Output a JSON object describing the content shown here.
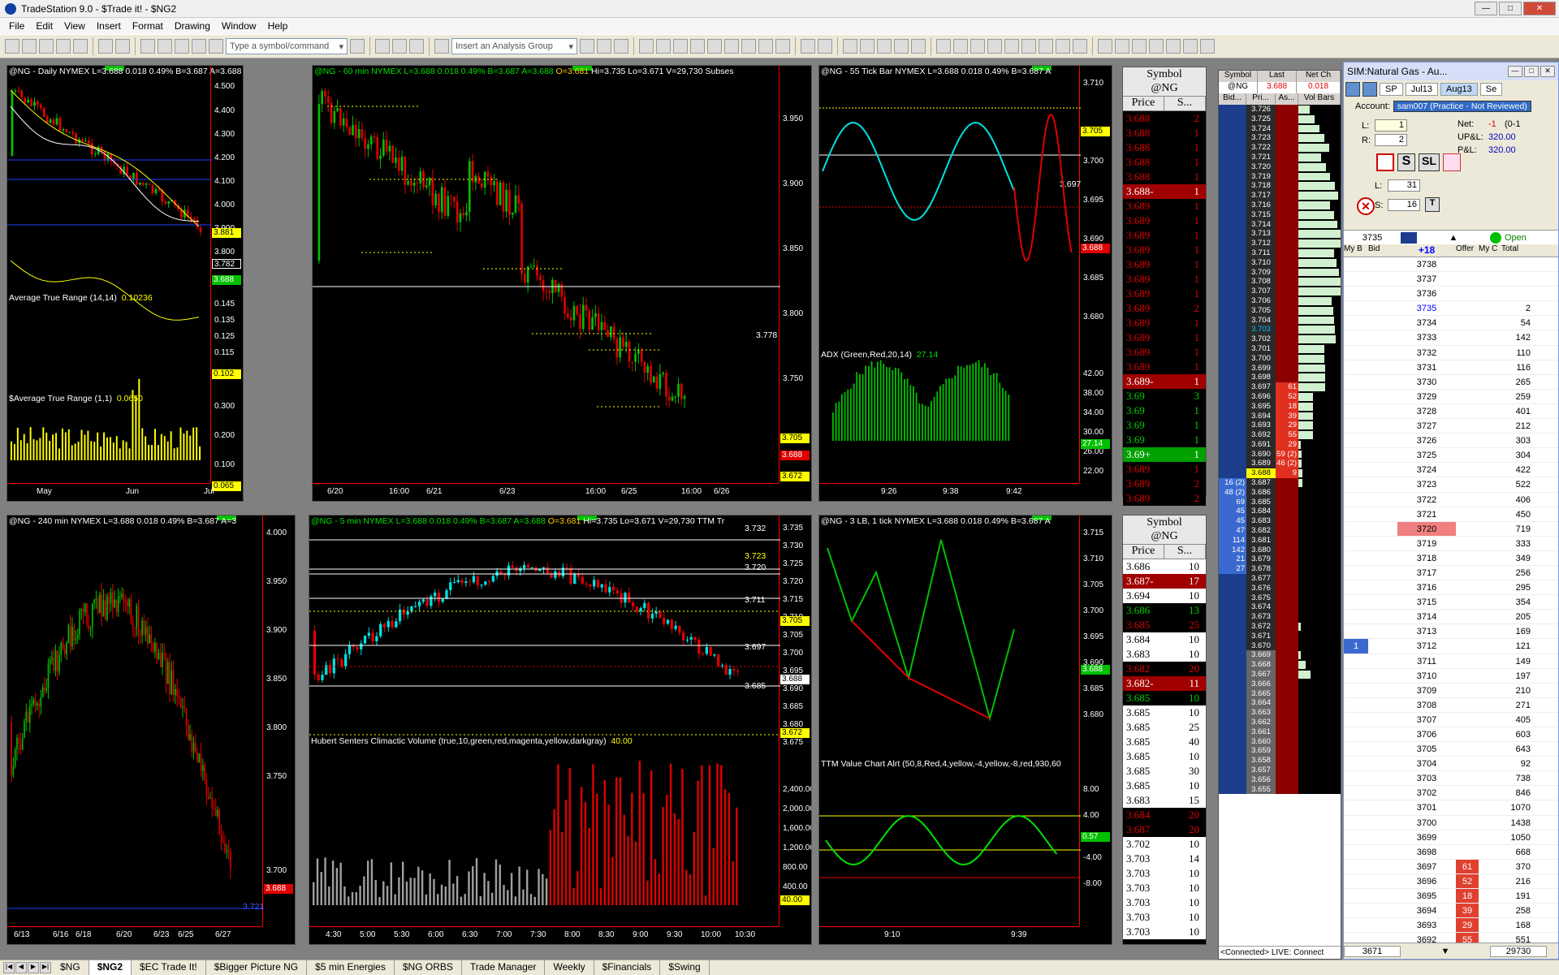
{
  "window": {
    "title": "TradeStation 9.0 - $Trade it! - $NG2"
  },
  "menu": [
    "File",
    "Edit",
    "View",
    "Insert",
    "Format",
    "Drawing",
    "Window",
    "Help"
  ],
  "toolbar": {
    "symbol_placeholder": "Type a symbol/command",
    "analysis_placeholder": "Insert an Analysis Group"
  },
  "charts": {
    "daily": {
      "header": "@NG - Daily  NYMEX  L=3.688  0.018  0.49%  B=3.687  A=3.688",
      "ticks": [
        "4.500",
        "4.400",
        "4.300",
        "4.200",
        "4.100",
        "4.000",
        "3.900",
        "3.800"
      ],
      "price_tags": [
        "3.881",
        "3.782",
        "3.688"
      ],
      "sub1_label": "Average True Range (14,14)",
      "sub1_value": "0.10236",
      "sub1_ticks": [
        "0.145",
        "0.135",
        "0.125",
        "0.115"
      ],
      "sub1_tag": "0.102",
      "sub2_label": "$Average True Range (1,1)",
      "sub2_value": "0.0650",
      "sub2_ticks": [
        "0.300",
        "0.200",
        "0.100"
      ],
      "sub2_tag": "0.065",
      "x": [
        "May",
        "Jun",
        "Jul"
      ]
    },
    "min60": {
      "header_a": "@NG - 60 min  NYMEX  L=3.688  0.018  0.49%  B=3.687  A=3.688  ",
      "header_o": "O=3.681",
      "header_b": "  Hi=3.735  Lo=3.671  V=29,730  Subses",
      "ticks": [
        "3.950",
        "3.900",
        "3.850",
        "3.800",
        "3.750"
      ],
      "line_label": "3.778",
      "price_tags": [
        "3.705",
        "3.688",
        "3.672"
      ],
      "x": [
        "6/20",
        "16:00",
        "6/21",
        "6/23",
        "16:00",
        "6/25",
        "16:00",
        "6/26"
      ]
    },
    "tick55": {
      "header": "@NG - 55 Tick Bar  NYMEX  L=3.688  0.018  0.49%  B=3.687  A",
      "ticks": [
        "3.710",
        "3.700",
        "3.695",
        "3.690",
        "3.685",
        "3.680"
      ],
      "line_label": "3.697",
      "price_tags": [
        "3.705",
        "3.688"
      ],
      "sub_label": "ADX (Green,Red,20,14)",
      "sub_value": "27.14",
      "sub_ticks": [
        "42.00",
        "38.00",
        "34.00",
        "30.00",
        "26.00",
        "22.00"
      ],
      "sub_tag": "27.14",
      "x": [
        "9:26",
        "9:38",
        "9:42"
      ]
    },
    "min240": {
      "header": "@NG - 240 min  NYMEX  L=3.688  0.018  0.49%  B=3.687  A=3",
      "ticks": [
        "4.000",
        "3.950",
        "3.900",
        "3.850",
        "3.800",
        "3.750",
        "3.700"
      ],
      "line_label": "3.721",
      "price_tags": [
        "3.688"
      ],
      "x": [
        "6/13",
        "6/16",
        "6/18",
        "6/20",
        "6/23",
        "6/25",
        "6/27"
      ]
    },
    "min5": {
      "header_a": "@NG - 5 min  NYMEX  L=3.688  0.018  0.49%  B=3.687  A=3.688  ",
      "header_o": "O=3.681",
      "header_b": "  Hi=3.735  Lo=3.671  V=29,730  TTM Tr",
      "ticks": [
        "3.735",
        "3.730",
        "3.725",
        "3.720",
        "3.715",
        "3.710",
        "3.705",
        "3.700",
        "3.695",
        "3.690",
        "3.685",
        "3.680",
        "3.675"
      ],
      "line_labels": [
        "3.732",
        "3.723",
        "3.720",
        "3.711",
        "3.697",
        "3.685"
      ],
      "price_tags": [
        "3.705",
        "3.688",
        "3.672"
      ],
      "sub_label": "Hubert Senters Climactic Volume (true,10,green,red,magenta,yellow,darkgray)",
      "sub_value": "40.00",
      "sub_ticks": [
        "2,400.00",
        "2,000.00",
        "1,600.00",
        "1,200.00",
        "800.00",
        "400.00"
      ],
      "sub_tag": "40.00",
      "x": [
        "4:30",
        "5:00",
        "5:30",
        "6:00",
        "6:30",
        "7:00",
        "7:30",
        "8:00",
        "8:30",
        "9:00",
        "9:30",
        "10:00",
        "10:30"
      ]
    },
    "lb3": {
      "header": "@NG - 3 LB, 1 tick  NYMEX  L=3.688  0.018  0.49%  B=3.687  A",
      "ticks": [
        "3.715",
        "3.710",
        "3.705",
        "3.700",
        "3.695",
        "3.690",
        "3.685",
        "3.680"
      ],
      "price_tags": [
        "3.688"
      ],
      "sub_label": "TTM Value Chart Alrt (50,8,Red,4,yellow,-4,yellow,-8,red,930,60",
      "sub_ticks": [
        "8.00",
        "4.00",
        "-4.00",
        "-8.00"
      ],
      "sub_tag": "0.57",
      "x": [
        "9:10",
        "9:39"
      ]
    }
  },
  "matrix_top": {
    "title1": "Symbol",
    "title2": "@NG",
    "col_price": "Price",
    "col_size": "S...",
    "rows": [
      [
        "3.688",
        "2"
      ],
      [
        "3.688",
        "1"
      ],
      [
        "3.688",
        "1"
      ],
      [
        "3.688",
        "1"
      ],
      [
        "3.688",
        "1"
      ],
      [
        "3.688-",
        "1"
      ],
      [
        "3.689",
        "1"
      ],
      [
        "3.689",
        "1"
      ],
      [
        "3.689",
        "1"
      ],
      [
        "3.689",
        "1"
      ],
      [
        "3.689",
        "1"
      ],
      [
        "3.689",
        "1"
      ],
      [
        "3.689",
        "1"
      ],
      [
        "3.689",
        "2"
      ],
      [
        "3.689",
        "1"
      ],
      [
        "3.689",
        "1"
      ],
      [
        "3.689",
        "1"
      ],
      [
        "3.689",
        "1"
      ],
      [
        "3.689-",
        "1"
      ],
      [
        "3.69",
        "3"
      ],
      [
        "3.69",
        "1"
      ],
      [
        "3.69",
        "1"
      ],
      [
        "3.69",
        "1"
      ],
      [
        "3.69+",
        "1"
      ],
      [
        "3.689",
        "1"
      ],
      [
        "3.689",
        "2"
      ],
      [
        "3.689",
        "2"
      ]
    ]
  },
  "matrix_bot": {
    "title1": "Symbol",
    "title2": "@NG",
    "col_price": "Price",
    "col_size": "S...",
    "rows": [
      [
        "3.686",
        "10"
      ],
      [
        "3.687-",
        "17"
      ],
      [
        "3.694",
        "10"
      ],
      [
        "3.686",
        "13"
      ],
      [
        "3.685",
        "25"
      ],
      [
        "3.684",
        "10"
      ],
      [
        "3.683",
        "10"
      ],
      [
        "3.682",
        "20"
      ],
      [
        "3.682-",
        "11"
      ],
      [
        "3.685",
        "10"
      ],
      [
        "3.685",
        "10"
      ],
      [
        "3.685",
        "25"
      ],
      [
        "3.685",
        "40"
      ],
      [
        "3.685",
        "10"
      ],
      [
        "3.685",
        "30"
      ],
      [
        "3.685",
        "10"
      ],
      [
        "3.683",
        "15"
      ],
      [
        "3.684",
        "20"
      ],
      [
        "3.687",
        "20"
      ],
      [
        "3.702",
        "10"
      ],
      [
        "3.703",
        "14"
      ],
      [
        "3.703",
        "10"
      ],
      [
        "3.703",
        "10"
      ],
      [
        "3.703",
        "10"
      ],
      [
        "3.703",
        "10"
      ],
      [
        "3.703",
        "10"
      ]
    ]
  },
  "ladder": {
    "col_symbol": "Symbol",
    "col_last": "Last",
    "col_net": "Net Ch",
    "symbol": "@NG",
    "last": "3.688",
    "net": "0.018",
    "col_bid": "Bid...",
    "col_pri": "Pri...",
    "col_ask": "As...",
    "col_vol": "Vol Bars",
    "status": "<Connected> LIVE: Connect",
    "rows": [
      [
        "",
        "3.726",
        ""
      ],
      [
        "",
        "3.725",
        ""
      ],
      [
        "",
        "3.724",
        ""
      ],
      [
        "",
        "3.723",
        ""
      ],
      [
        "",
        "3.722",
        ""
      ],
      [
        "",
        "3.721",
        ""
      ],
      [
        "",
        "3.720",
        ""
      ],
      [
        "",
        "3.719",
        ""
      ],
      [
        "",
        "3.718",
        ""
      ],
      [
        "",
        "3.717",
        ""
      ],
      [
        "",
        "3.716",
        ""
      ],
      [
        "",
        "3.715",
        ""
      ],
      [
        "",
        "3.714",
        ""
      ],
      [
        "",
        "3.713",
        ""
      ],
      [
        "",
        "3.712",
        ""
      ],
      [
        "",
        "3.711",
        ""
      ],
      [
        "",
        "3.710",
        ""
      ],
      [
        "",
        "3.709",
        ""
      ],
      [
        "",
        "3.708",
        ""
      ],
      [
        "",
        "3.707",
        ""
      ],
      [
        "",
        "3.706",
        ""
      ],
      [
        "",
        "3.705",
        ""
      ],
      [
        "",
        "3.704",
        ""
      ],
      [
        "",
        "3.703",
        ""
      ],
      [
        "",
        "3.702",
        ""
      ],
      [
        "",
        "3.701",
        ""
      ],
      [
        "",
        "3.700",
        ""
      ],
      [
        "",
        "3.699",
        ""
      ],
      [
        "",
        "3.698",
        ""
      ],
      [
        "",
        "3.697",
        "61"
      ],
      [
        "",
        "3.696",
        "52"
      ],
      [
        "",
        "3.695",
        "18"
      ],
      [
        "",
        "3.694",
        "39"
      ],
      [
        "",
        "3.693",
        "29"
      ],
      [
        "",
        "3.692",
        "55"
      ],
      [
        "",
        "3.691",
        "29"
      ],
      [
        "",
        "3.690",
        "59 (2)"
      ],
      [
        "",
        "3.689",
        "46 (2)"
      ],
      [
        "",
        "3.688",
        "9"
      ],
      [
        "16 (2)",
        "3.687",
        ""
      ],
      [
        "48 (2)",
        "3.686",
        ""
      ],
      [
        "69",
        "3.685",
        ""
      ],
      [
        "45",
        "3.684",
        ""
      ],
      [
        "45",
        "3.683",
        ""
      ],
      [
        "47",
        "3.682",
        ""
      ],
      [
        "114",
        "3.681",
        ""
      ],
      [
        "142",
        "3.680",
        ""
      ],
      [
        "21",
        "3.679",
        ""
      ],
      [
        "27",
        "3.678",
        ""
      ],
      [
        "",
        "3.677",
        ""
      ],
      [
        "",
        "3.676",
        ""
      ],
      [
        "",
        "3.675",
        ""
      ],
      [
        "",
        "3.674",
        ""
      ],
      [
        "",
        "3.673",
        ""
      ],
      [
        "",
        "3.672",
        ""
      ],
      [
        "",
        "3.671",
        ""
      ],
      [
        "",
        "3.670",
        ""
      ],
      [
        "",
        "3.669",
        ""
      ],
      [
        "",
        "3.668",
        ""
      ],
      [
        "",
        "3.667",
        ""
      ],
      [
        "",
        "3.666",
        ""
      ],
      [
        "",
        "3.665",
        ""
      ],
      [
        "",
        "3.664",
        ""
      ],
      [
        "",
        "3.663",
        ""
      ],
      [
        "",
        "3.662",
        ""
      ],
      [
        "",
        "3.661",
        ""
      ],
      [
        "",
        "3.660",
        ""
      ],
      [
        "",
        "3.659",
        ""
      ],
      [
        "",
        "3.658",
        ""
      ],
      [
        "",
        "3.657",
        ""
      ],
      [
        "",
        "3.656",
        ""
      ],
      [
        "",
        "3.655",
        ""
      ]
    ]
  },
  "sim": {
    "title": "SIM:Natural Gas - Au...",
    "sp": "SP",
    "exp1": "Jul13",
    "exp2": "Aug13",
    "exp3": "Se",
    "account_label": "Account:",
    "account": "sam007 (Practice - Not Reviewed)",
    "l_label": "L:",
    "l_val": "1",
    "r_label": "R:",
    "r_val": "2",
    "net_label": "Net:",
    "net_val": "-1",
    "net_extra": "(0-1",
    "upl_label": "UP&L:",
    "upl_val": "320.00",
    "pl_label": "P&L:",
    "pl_val": "320.00",
    "s_btn": "S",
    "sl_btn": "SL",
    "l2_label": "L:",
    "l2_val": "31",
    "s_label": "S:",
    "s_val": "16",
    "t_btn": "T",
    "price_box": "3735",
    "status": "Open",
    "plus": "+18",
    "cols": [
      "My B",
      "Bid",
      "",
      "Offer",
      "My C",
      "Total"
    ],
    "rows": [
      [
        "",
        "",
        "3738",
        "",
        "",
        "",
        ""
      ],
      [
        "",
        "",
        "3737",
        "",
        "",
        "",
        ""
      ],
      [
        "",
        "",
        "3736",
        "",
        "",
        "",
        ""
      ],
      [
        "",
        "",
        "3735",
        "",
        "",
        "2",
        ""
      ],
      [
        "",
        "",
        "3734",
        "",
        "",
        "54",
        ""
      ],
      [
        "",
        "",
        "3733",
        "",
        "",
        "142",
        ""
      ],
      [
        "",
        "",
        "3732",
        "",
        "",
        "110",
        ""
      ],
      [
        "",
        "",
        "3731",
        "",
        "",
        "116",
        ""
      ],
      [
        "",
        "",
        "3730",
        "",
        "",
        "265",
        ""
      ],
      [
        "",
        "",
        "3729",
        "",
        "",
        "259",
        ""
      ],
      [
        "",
        "",
        "3728",
        "",
        "",
        "401",
        ""
      ],
      [
        "",
        "",
        "3727",
        "",
        "",
        "212",
        ""
      ],
      [
        "",
        "",
        "3726",
        "",
        "",
        "303",
        ""
      ],
      [
        "",
        "",
        "3725",
        "",
        "",
        "304",
        ""
      ],
      [
        "",
        "",
        "3724",
        "",
        "",
        "422",
        ""
      ],
      [
        "",
        "",
        "3723",
        "",
        "",
        "522",
        ""
      ],
      [
        "",
        "",
        "3722",
        "",
        "",
        "406",
        ""
      ],
      [
        "",
        "",
        "3721",
        "",
        "",
        "450",
        ""
      ],
      [
        "",
        "",
        "3720",
        "",
        "",
        "719",
        ""
      ],
      [
        "",
        "",
        "3719",
        "",
        "",
        "333",
        ""
      ],
      [
        "",
        "",
        "3718",
        "",
        "",
        "349",
        ""
      ],
      [
        "",
        "",
        "3717",
        "",
        "",
        "256",
        ""
      ],
      [
        "",
        "",
        "3716",
        "",
        "",
        "295",
        ""
      ],
      [
        "",
        "",
        "3715",
        "",
        "",
        "354",
        ""
      ],
      [
        "",
        "",
        "3714",
        "",
        "",
        "205",
        ""
      ],
      [
        "",
        "",
        "3713",
        "",
        "",
        "169",
        ""
      ],
      [
        "1",
        "",
        "3712",
        "",
        "",
        "121",
        ""
      ],
      [
        "",
        "",
        "3711",
        "",
        "",
        "149",
        ""
      ],
      [
        "",
        "",
        "3710",
        "",
        "",
        "197",
        ""
      ],
      [
        "",
        "",
        "3709",
        "",
        "",
        "210",
        ""
      ],
      [
        "",
        "",
        "3708",
        "",
        "",
        "271",
        ""
      ],
      [
        "",
        "",
        "3707",
        "",
        "",
        "405",
        ""
      ],
      [
        "",
        "",
        "3706",
        "",
        "",
        "603",
        ""
      ],
      [
        "",
        "",
        "3705",
        "",
        "",
        "643",
        ""
      ],
      [
        "",
        "",
        "3704",
        "",
        "",
        "92",
        ""
      ],
      [
        "",
        "",
        "3703",
        "",
        "",
        "738",
        ""
      ],
      [
        "",
        "",
        "3702",
        "",
        "",
        "846",
        ""
      ],
      [
        "",
        "",
        "3701",
        "",
        "",
        "1070",
        ""
      ],
      [
        "",
        "",
        "3700",
        "",
        "",
        "1438",
        ""
      ],
      [
        "",
        "",
        "3699",
        "",
        "",
        "1050",
        ""
      ],
      [
        "",
        "",
        "3698",
        "",
        "",
        "668",
        ""
      ],
      [
        "",
        "",
        "3697",
        "61",
        "",
        "370",
        ""
      ],
      [
        "",
        "",
        "3696",
        "52",
        "",
        "216",
        ""
      ],
      [
        "",
        "",
        "3695",
        "18",
        "",
        "191",
        ""
      ],
      [
        "",
        "",
        "3694",
        "39",
        "",
        "258",
        ""
      ],
      [
        "",
        "",
        "3693",
        "29",
        "",
        "168",
        ""
      ],
      [
        "",
        "",
        "3692",
        "55",
        "",
        "551",
        ""
      ]
    ],
    "bottom_left": "3671",
    "bottom_right": "29730"
  },
  "tabs": [
    "$NG",
    "$NG2",
    "$EC Trade It!",
    "$Bigger Picture NG",
    "$5 min Energies",
    "$NG ORBS",
    "Trade Manager",
    "Weekly",
    "$Financials",
    "$Swing"
  ],
  "colors": {
    "up": "#00c000",
    "down": "#e00000",
    "cyan": "#00e0e0",
    "yellow": "#ffff00",
    "bid": "#1c3d8c",
    "ask": "#8c0000"
  }
}
